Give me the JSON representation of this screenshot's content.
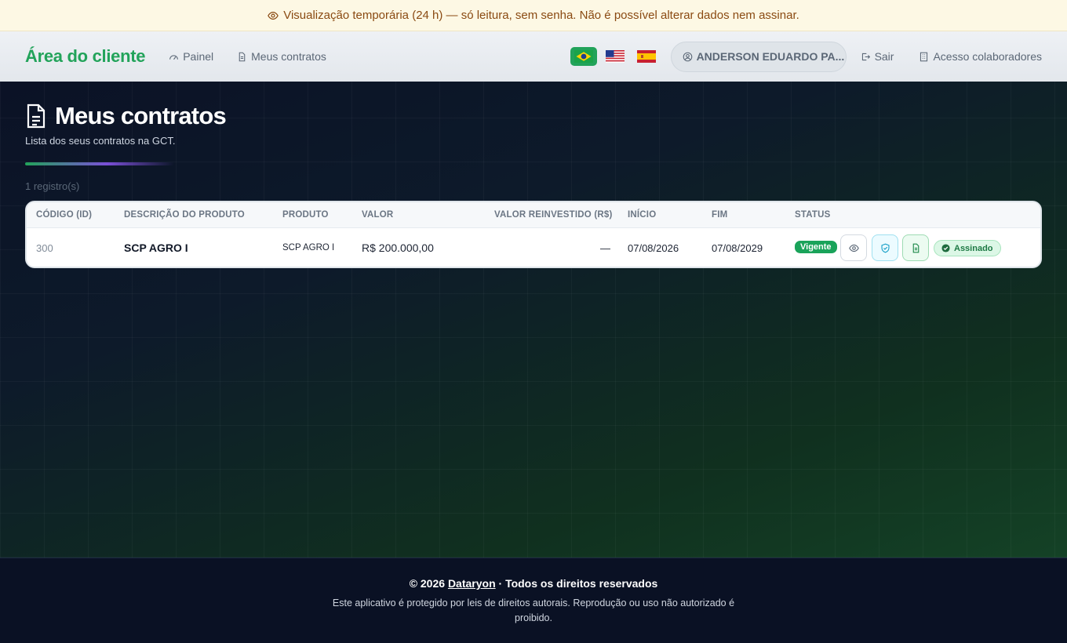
{
  "banner": {
    "text": "Visualização temporária (24 h) — só leitura, sem senha. Não é possível alterar dados nem assinar."
  },
  "nav": {
    "brand": "Área do cliente",
    "links": [
      {
        "label": "Painel",
        "icon": "gauge-icon"
      },
      {
        "label": "Meus contratos",
        "icon": "document-icon"
      }
    ],
    "languages": [
      {
        "code": "pt-BR",
        "active": true
      },
      {
        "code": "en-US",
        "active": false
      },
      {
        "code": "es-ES",
        "active": false
      }
    ],
    "user": "ANDERSON EDUARDO PA...",
    "logout": "Sair",
    "staff_access": "Acesso colaboradores"
  },
  "page": {
    "title": "Meus contratos",
    "subtitle": "Lista dos seus contratos na GCT.",
    "count": "1 registro(s)"
  },
  "table": {
    "columns": [
      "CÓDIGO (ID)",
      "DESCRIÇÃO DO PRODUTO",
      "PRODUTO",
      "VALOR",
      "VALOR REINVESTIDO (R$)",
      "INÍCIO",
      "FIM",
      "STATUS"
    ],
    "rows": [
      {
        "id": "300",
        "description": "SCP AGRO I",
        "product": "SCP AGRO I",
        "value": "R$ 200.000,00",
        "reinvested": "—",
        "start": "07/08/2026",
        "end": "07/08/2029",
        "status": "Vigente",
        "signature": "Assinado"
      }
    ]
  },
  "footer": {
    "year_prefix": "© 2026",
    "company": "Dataryon",
    "rights": "· Todos os direitos reservados",
    "notice": "Este aplicativo é protegido por leis de direitos autorais. Reprodução ou uso não autorizado é proibido."
  },
  "colors": {
    "brand_green": "#22a35a",
    "banner_text": "#8a4a12",
    "background_dark": "#0b1226"
  }
}
